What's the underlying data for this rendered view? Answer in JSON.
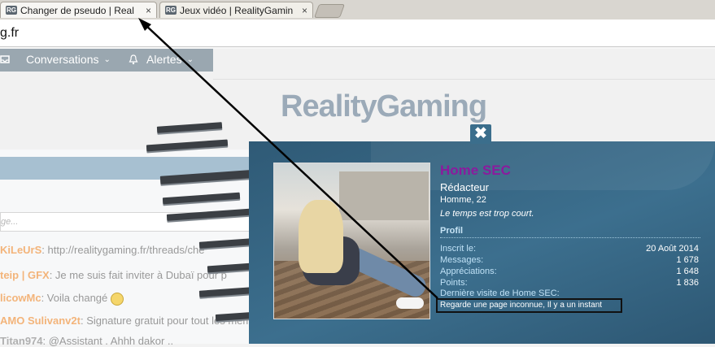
{
  "browser": {
    "tabs": [
      {
        "favicon": "RG",
        "title": "Changer de pseudo | Real",
        "close": "×"
      },
      {
        "favicon": "RG",
        "title": "Jeux vidéo | RealityGamin",
        "close": "×"
      }
    ],
    "url": "g.fr"
  },
  "nav": {
    "conversations": {
      "icon": "inbox-icon",
      "label": "Conversations",
      "chevron": "⌄"
    },
    "alerts": {
      "icon": "bell-icon",
      "label": "Alertes",
      "chevron": "⌄"
    }
  },
  "site": {
    "logo": "RealityGaming"
  },
  "chat": {
    "input_placeholder": "ge...",
    "messages": [
      {
        "user": "KiLeUrS",
        "text": ": http://realitygaming.fr/threads/che"
      },
      {
        "user": "teip | GFX",
        "text": ": Je me suis fait inviter à Dubaï pour p"
      },
      {
        "user": "licowMc",
        "text": ": Voila changé"
      },
      {
        "user": "AMO Sulivanv2t",
        "text": ": Signature gratuit pour tout les mem"
      },
      {
        "user": "Titan974",
        "text": ": @Assistant . Ahhh dakor .."
      }
    ]
  },
  "profile": {
    "close_label": "✖",
    "username": "Home SEC",
    "username_color": "#8b1b9e",
    "role": "Rédacteur",
    "info": "Homme, 22",
    "status": "Le temps est trop court.",
    "section": "Profil",
    "stats": [
      {
        "label": "Inscrit le:",
        "value": "20 Août 2014"
      },
      {
        "label": "Messages:",
        "value": "1 678"
      },
      {
        "label": "Appréciations:",
        "value": "1 648"
      },
      {
        "label": "Points:",
        "value": "1 836"
      }
    ],
    "last_visit_label": "Dernière visite de Home SEC:",
    "last_visit": "Regarde une page inconnue, Il y a un instant"
  }
}
